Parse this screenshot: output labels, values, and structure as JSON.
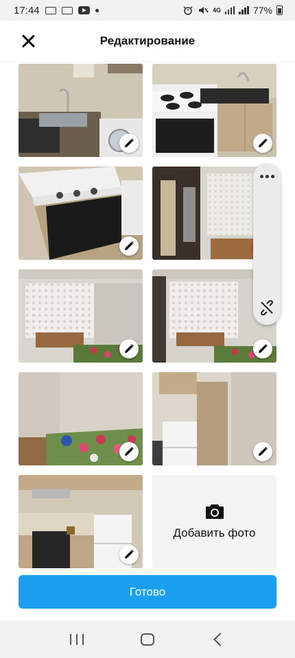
{
  "status_bar": {
    "time": "17:44",
    "battery": "77%",
    "network": "4G"
  },
  "header": {
    "title": "Редактирование"
  },
  "photos": [
    {
      "id": 1
    },
    {
      "id": 2
    },
    {
      "id": 3
    },
    {
      "id": 4
    },
    {
      "id": 5
    },
    {
      "id": 6
    },
    {
      "id": 7
    },
    {
      "id": 8
    },
    {
      "id": 9
    }
  ],
  "add_photo": {
    "label": "Добавить фото"
  },
  "done_button": {
    "label": "Готово"
  },
  "colors": {
    "accent": "#1aa0ee",
    "background": "#ffffff",
    "add_tile_bg": "#f4f4f4"
  }
}
